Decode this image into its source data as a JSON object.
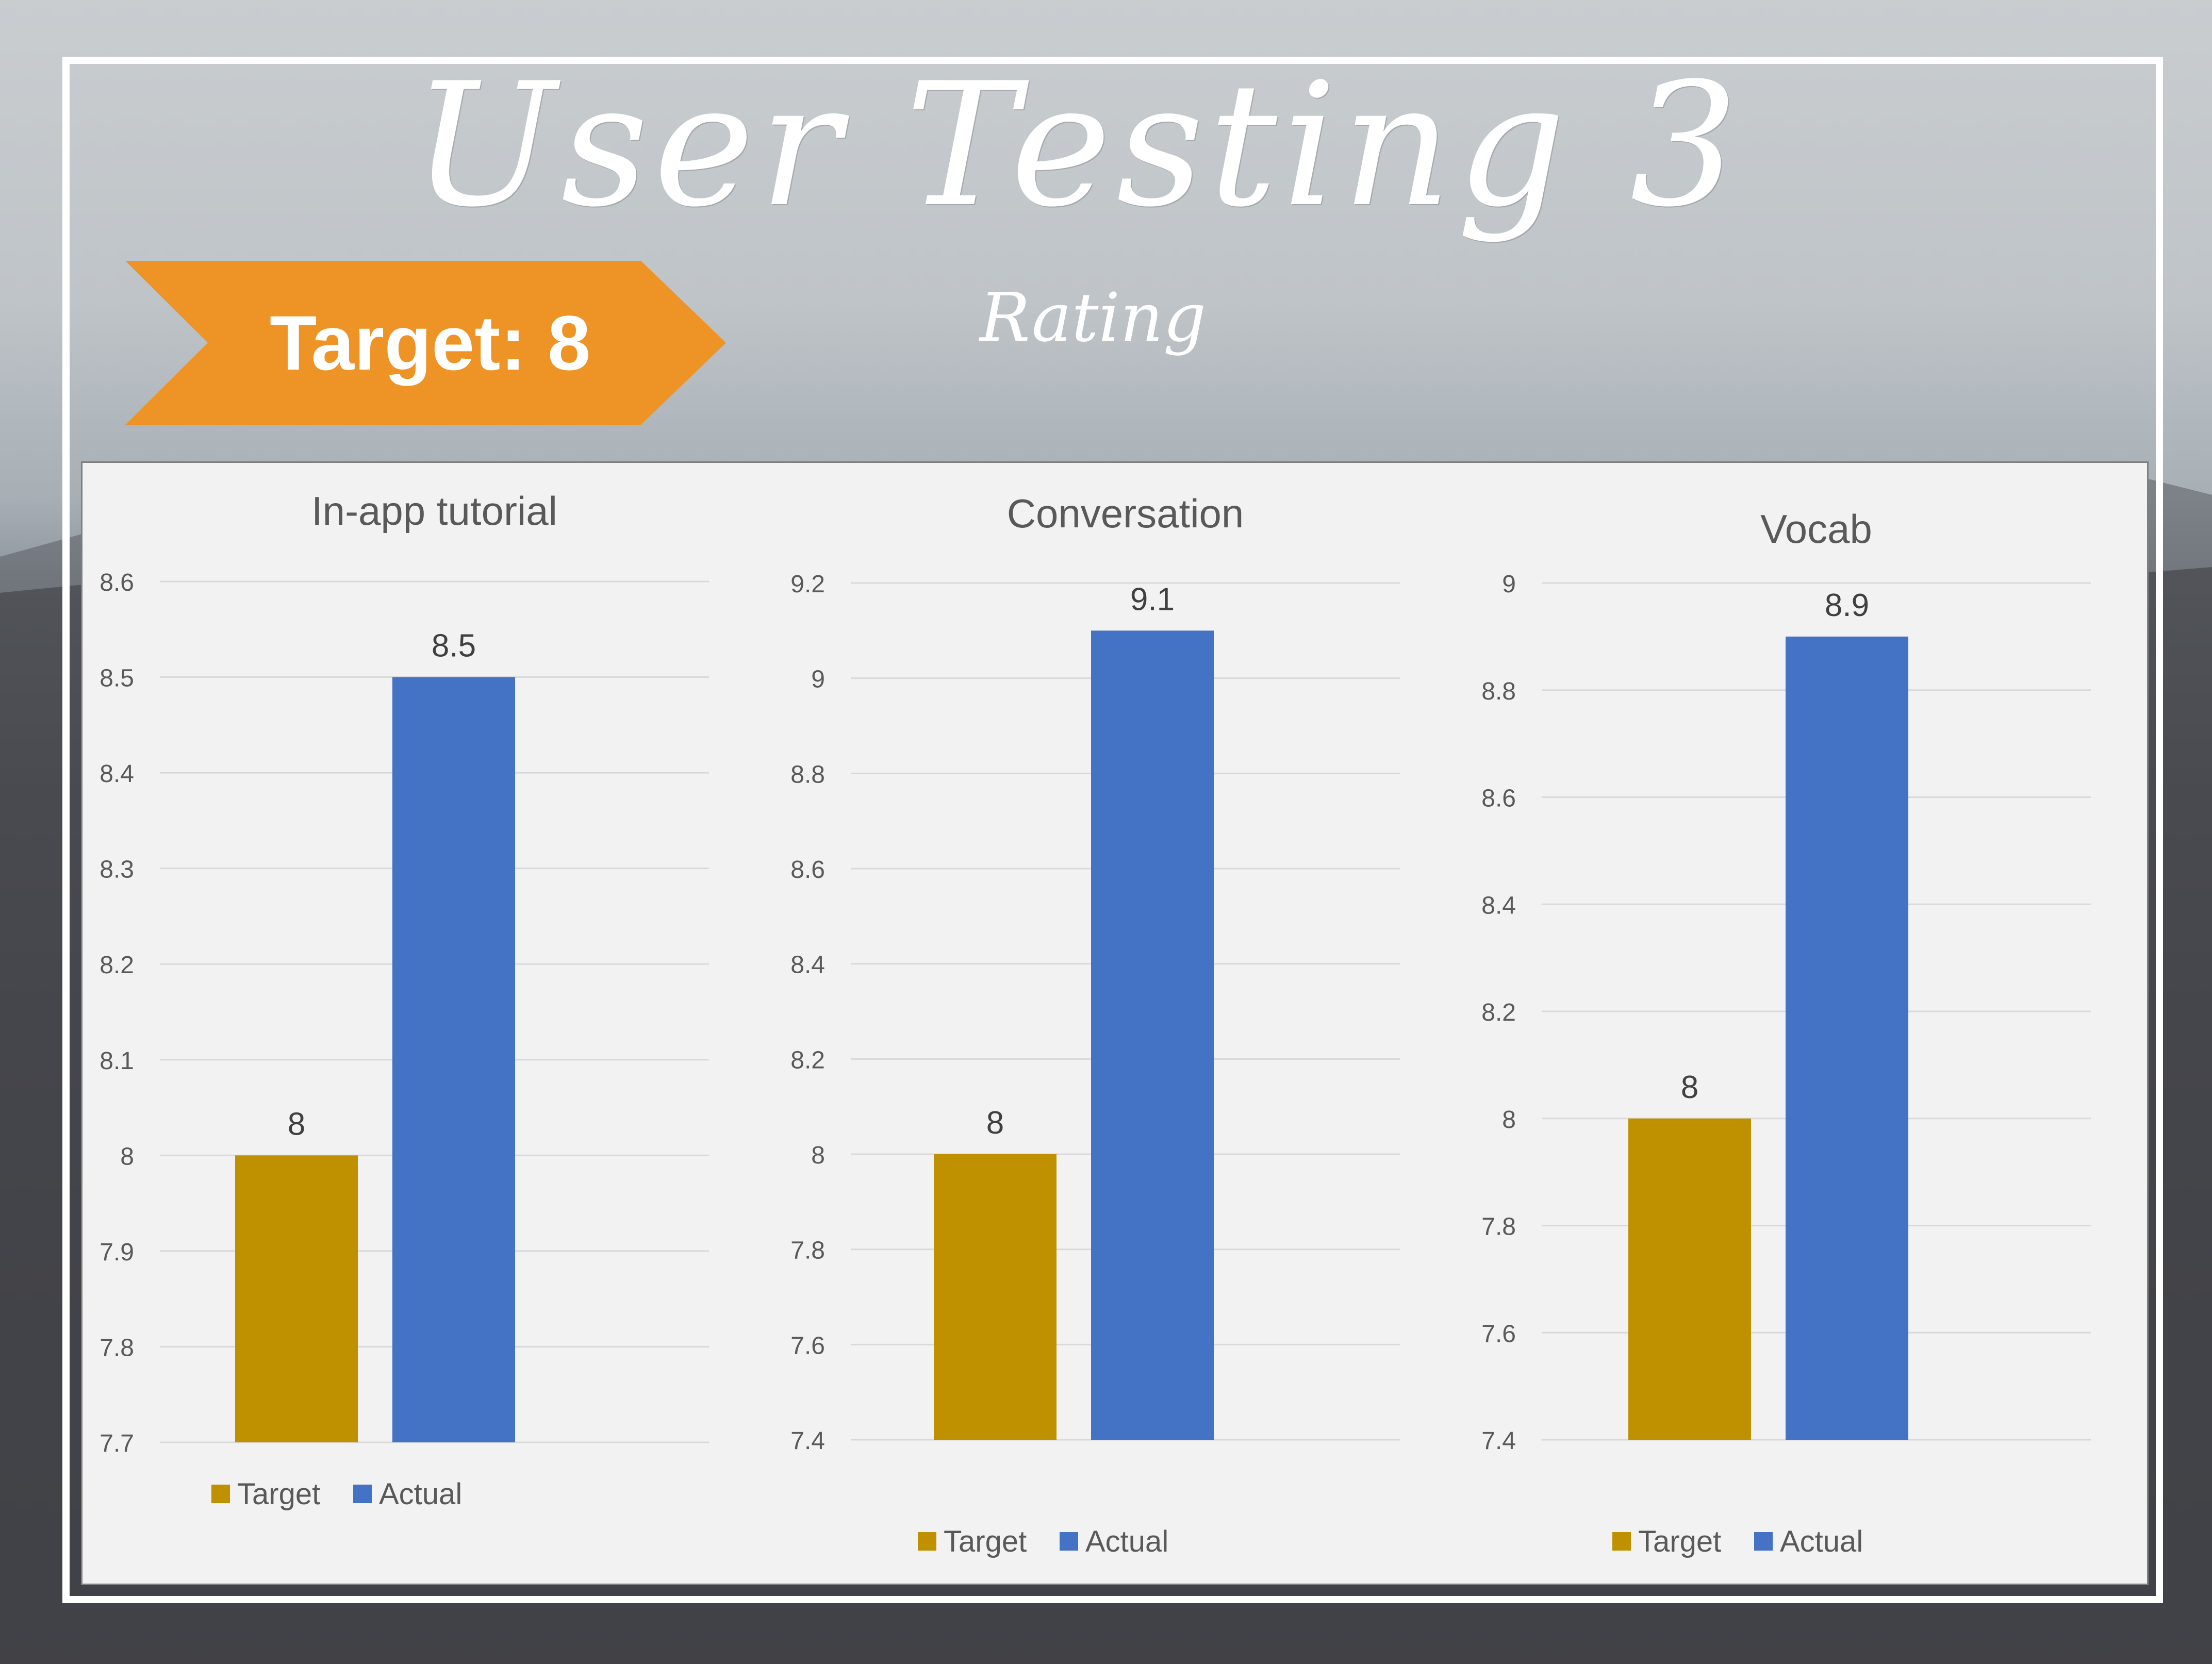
{
  "title": "User Testing 3",
  "subtitle": "Rating",
  "banner": {
    "label": "Target: 8",
    "color": "#ee9427"
  },
  "colors": {
    "target": "#bf9000",
    "actual": "#4472c4"
  },
  "chart_data": [
    {
      "type": "bar",
      "title": "In-app tutorial",
      "categories": [
        "Target",
        "Actual"
      ],
      "values": [
        8,
        8.5
      ],
      "data_labels": [
        "8",
        "8.5"
      ],
      "ylim": [
        7.7,
        8.6
      ],
      "yticks": [
        "7.7",
        "7.8",
        "7.9",
        "8",
        "8.1",
        "8.2",
        "8.3",
        "8.4",
        "8.5",
        "8.6"
      ],
      "grid": true,
      "legend": [
        "Target",
        "Actual"
      ],
      "legend_position": "bottom"
    },
    {
      "type": "bar",
      "title": "Conversation",
      "categories": [
        "Target",
        "Actual"
      ],
      "values": [
        8,
        9.1
      ],
      "data_labels": [
        "8",
        "9.1"
      ],
      "ylim": [
        7.4,
        9.2
      ],
      "yticks": [
        "7.4",
        "7.6",
        "7.8",
        "8",
        "8.2",
        "8.4",
        "8.6",
        "8.8",
        "9",
        "9.2"
      ],
      "grid": true,
      "legend": [
        "Target",
        "Actual"
      ],
      "legend_position": "bottom"
    },
    {
      "type": "bar",
      "title": "Vocab",
      "categories": [
        "Target",
        "Actual"
      ],
      "values": [
        8,
        8.9
      ],
      "data_labels": [
        "8",
        "8.9"
      ],
      "ylim": [
        7.4,
        9
      ],
      "yticks": [
        "7.4",
        "7.6",
        "7.8",
        "8",
        "8.2",
        "8.4",
        "8.6",
        "8.8",
        "9"
      ],
      "grid": true,
      "legend": [
        "Target",
        "Actual"
      ],
      "legend_position": "bottom"
    }
  ]
}
